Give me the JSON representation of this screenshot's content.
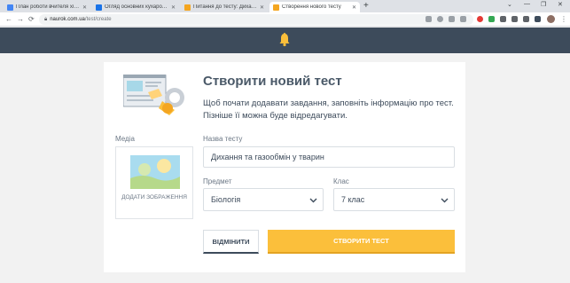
{
  "browser": {
    "tabs": [
      {
        "title": "План роботи вчителя хімії, біол",
        "favicon_color": "#4285f4"
      },
      {
        "title": "Огляд основних кухарологічних",
        "favicon_color": "#1a73e8"
      },
      {
        "title": "Питання до тесту: Дихання та га",
        "favicon_color": "#f4a621"
      },
      {
        "title": "Створення нового тесту",
        "favicon_color": "#f4a621"
      }
    ],
    "new_tab_icon": "+",
    "url_host": "naurok.com.ua",
    "url_path": "/test/create",
    "window_controls": [
      "⌄",
      "—",
      "❐",
      "✕"
    ],
    "nav_icons": [
      "←",
      "→",
      "⟳"
    ]
  },
  "site": {
    "header_color": "#3d4b5b",
    "logo_icon": "bell-icon",
    "accent": "#fbbf3b"
  },
  "form": {
    "title": "Створити новий тест",
    "subtitle": "Щоб почати додавати завдання, заповніть інформацію про тест. Пізніше її можна буде відредагувати.",
    "media_label": "Медіа",
    "media_add_text": "ДОДАТИ ЗОБРАЖЕННЯ",
    "test_name_label": "Назва тесту",
    "test_name_value": "Дихання та газообмін у тварин",
    "subject_label": "Предмет",
    "subject_value": "Біологія",
    "grade_label": "Клас",
    "grade_value": "7 клас",
    "cancel_label": "ВІДМІНИТИ",
    "create_label": "СТВОРИТИ ТЕСТ"
  }
}
